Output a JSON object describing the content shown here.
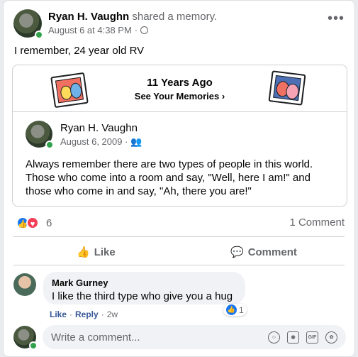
{
  "header": {
    "author": "Ryan H. Vaughn",
    "action": "shared a memory.",
    "date": "August 6 at 4:38 PM",
    "date_sep": "·"
  },
  "post": {
    "text": "I remember, 24 year old RV"
  },
  "memory": {
    "title": "11 Years Ago",
    "link": "See Your Memories",
    "author": "Ryan H. Vaughn",
    "date": "August 6, 2009",
    "date_sep": "·",
    "body": "Always remember there are two types of people in this world. Those who come into a room and say, \"Well, here I am!\" and those who come in and say, \"Ah, there you are!\""
  },
  "reactions": {
    "count": "6",
    "comments": "1 Comment"
  },
  "actions": {
    "like": "Like",
    "comment": "Comment"
  },
  "comment": {
    "author": "Mark Gurney",
    "text": "I like the third type who give you a hug",
    "reaction_count": "1",
    "like": "Like",
    "reply": "Reply",
    "sep": "·",
    "age": "2w"
  },
  "composer": {
    "placeholder": "Write a comment...",
    "gif_label": "GIF"
  },
  "colors": {
    "accent": "#1877f2",
    "love": "#f33e58",
    "online": "#31a24c"
  }
}
